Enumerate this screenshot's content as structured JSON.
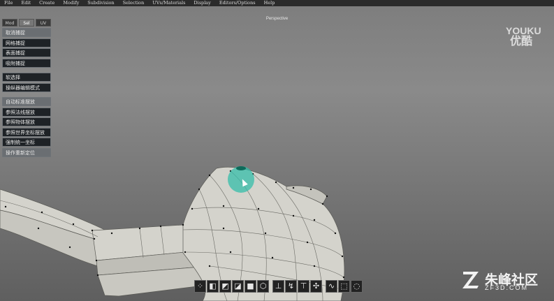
{
  "menu": [
    "File",
    "Edit",
    "Create",
    "Modify",
    "Subdivision",
    "Selection",
    "UVs/Materials",
    "Display",
    "Editors/Options",
    "Help"
  ],
  "viewport": {
    "title": "Perspective"
  },
  "panel": {
    "tabs": [
      {
        "label": "Mod"
      },
      {
        "label": "Sel"
      },
      {
        "label": "UV"
      }
    ],
    "group1": [
      "取消捕捉",
      "网格捕捉",
      "表面捕捉",
      "吸附捕捉"
    ],
    "group2": [
      "软选择",
      "操纵器编辑模式"
    ],
    "group3": [
      "自动标准摆放",
      "参照法线摆放",
      "参照物体摆放",
      "参照世界坐标摆放",
      "强制统一坐标",
      "操作重新定位"
    ]
  },
  "toolbar_icons": [
    "vertex-snap-icon",
    "face-icon",
    "cube-front-icon",
    "cube-side-icon",
    "cube-solid-icon",
    "sphere-icon",
    "move-tool-icon",
    "rotate-tool-icon",
    "scale-tool-icon",
    "universal-tool-icon",
    "curve-icon",
    "marquee-select-icon",
    "lasso-select-icon"
  ],
  "watermarks": {
    "youku_en": "YOUKU",
    "youku_cn": "优酷",
    "site_name": "朱峰社区",
    "site_url": "ZF3D.COM"
  },
  "colors": {
    "menubar": "#2b2b2b",
    "panel_button": "#1e2226",
    "mesh_fill": "#d4d3cc",
    "cursor_highlight": "#36beaa"
  }
}
